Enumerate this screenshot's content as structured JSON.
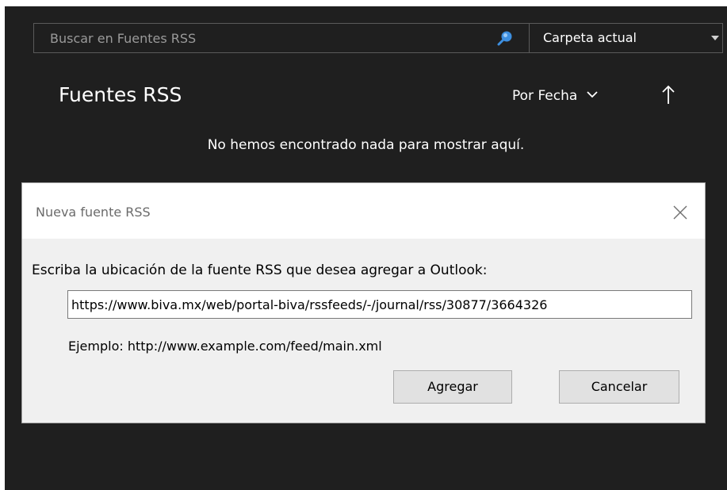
{
  "search": {
    "placeholder": "Buscar en Fuentes RSS",
    "scope": "Carpeta actual"
  },
  "folder": {
    "title": "Fuentes RSS",
    "sort_label": "Por Fecha",
    "empty_message": "No hemos encontrado nada para mostrar aquí."
  },
  "dialog": {
    "title": "Nueva fuente RSS",
    "prompt": "Escriba la ubicación de la fuente RSS que desea agregar a Outlook:",
    "url_value": "https://www.biva.mx/web/portal-biva/rssfeeds/-/journal/rss/30877/3664326",
    "example": "Ejemplo: http://www.example.com/feed/main.xml",
    "add_label": "Agregar",
    "cancel_label": "Cancelar"
  },
  "colors": {
    "window_background": "#1f1f1f",
    "dialog_background": "#f0f0f0",
    "search_icon": "#3d8fe0"
  },
  "icons": [
    "search-icon",
    "chevron-down-icon",
    "arrow-up-icon",
    "close-icon",
    "caret-down-icon"
  ]
}
